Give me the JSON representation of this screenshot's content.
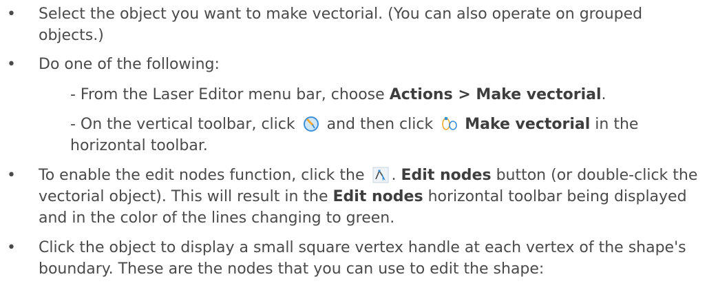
{
  "bullet": "•",
  "items": [
    {
      "text": "Select the object you want to make vectorial. (You can also operate on grouped objects.)"
    },
    {
      "text": "Do one of the following:"
    },
    {
      "text_a": "To enable the edit nodes function, click the",
      "text_b": ".",
      "bold_1": "Edit nodes",
      "text_c": "button (or double-click the vectorial object). This will result in the",
      "bold_2": "Edit nodes",
      "text_d": "horizontal toolbar being displayed and in the color of the lines changing to green."
    },
    {
      "text": "Click the object to display a small square vertex handle at each vertex of the shape's boundary. These are the nodes that you can use to edit the shape:"
    }
  ],
  "sub_items": [
    {
      "text_a": "- From the Laser Editor menu bar, choose",
      "bold": "Actions > Make vectorial",
      "text_b": "."
    },
    {
      "text_a": "- On the vertical toolbar, click",
      "text_b": "and then click",
      "bold": "Make vectorial",
      "text_c": "in the horizontal toolbar."
    }
  ],
  "icons": {
    "tools": "vectorial-tool-icon",
    "make_vectorial": "make-vectorial-icon",
    "edit_nodes": "edit-nodes-icon"
  },
  "colors": {
    "text": "#4a4a4a",
    "icon_blue": "#3b8fd9",
    "icon_orange": "#f0a830"
  }
}
